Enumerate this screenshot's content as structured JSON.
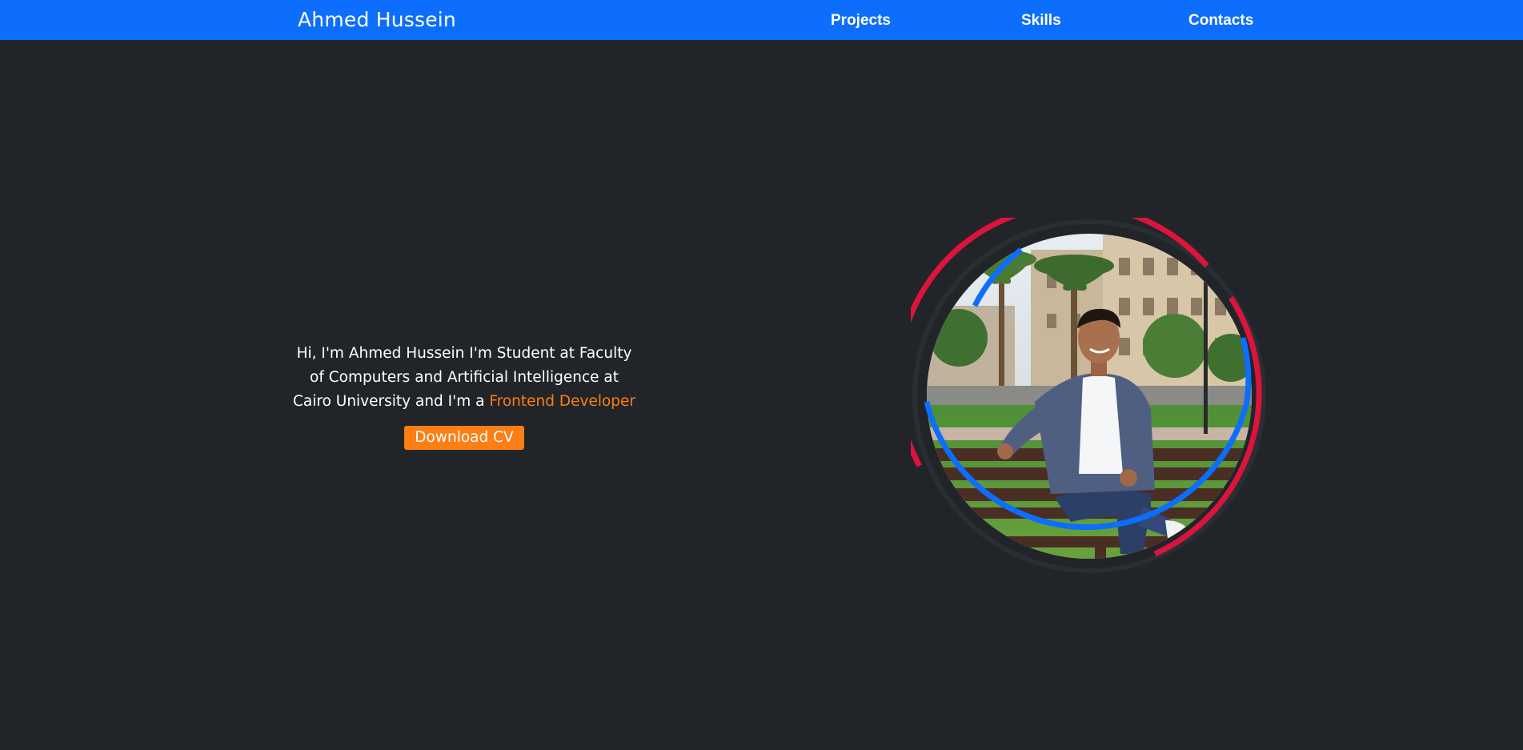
{
  "navbar": {
    "brand": "Ahmed Hussein",
    "links": [
      {
        "label": "Projects"
      },
      {
        "label": "Skills"
      },
      {
        "label": "Contacts"
      }
    ]
  },
  "hero": {
    "intro_text": "Hi, I'm Ahmed Hussein I'm Student at Faculty of Computers and Artificial Intelligence at Cairo University and I'm a",
    "role": "Frontend Developer",
    "cv_button": "Download CV"
  },
  "colors": {
    "navbar": "#0d6efd",
    "background": "#212529",
    "accent_orange": "#fd7e14",
    "ring_red": "#dc143c",
    "ring_blue": "#0d6efd"
  },
  "icons": {
    "profile_photo": "profile-photo"
  }
}
